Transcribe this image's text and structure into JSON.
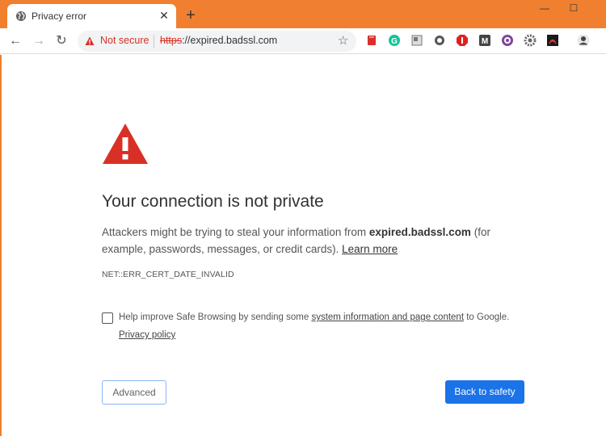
{
  "tab": {
    "title": "Privacy error",
    "close_glyph": "✕",
    "new_tab_glyph": "+"
  },
  "window": {
    "minimize_glyph": "—",
    "maximize_glyph": "☐"
  },
  "toolbar": {
    "back_glyph": "←",
    "forward_glyph": "→",
    "reload_glyph": "↻",
    "security_label": "Not secure",
    "url_scheme": "https",
    "url_rest": "://expired.badssl.com",
    "star_glyph": "☆"
  },
  "extensions": [
    {
      "name": "book-extension-icon",
      "color": "#d9302c"
    },
    {
      "name": "grammarly-extension-icon",
      "color": "#15c39a"
    },
    {
      "name": "screenshot-extension-icon",
      "color": "#777777"
    },
    {
      "name": "circle-extension-icon",
      "color": "#555555"
    },
    {
      "name": "adblock-extension-icon",
      "color": "#e02020"
    },
    {
      "name": "m-extension-icon",
      "color": "#444444"
    },
    {
      "name": "tor-extension-icon",
      "color": "#7d4698"
    },
    {
      "name": "gear-extension-icon",
      "color": "#666666"
    },
    {
      "name": "pdf-extension-icon",
      "color": "#1a1a1a"
    },
    {
      "name": "profile-avatar-icon",
      "color": "#444444"
    }
  ],
  "interstitial": {
    "heading": "Your connection is not private",
    "desc_before": "Attackers might be trying to steal your information from ",
    "desc_host": "expired.badssl.com",
    "desc_after": " (for example, passwords, messages, or credit cards). ",
    "learn_more": "Learn more",
    "error_code": "NET::ERR_CERT_DATE_INVALID",
    "safe_browsing_before": "Help improve Safe Browsing by sending some ",
    "safe_browsing_link": "system information and page content",
    "safe_browsing_after": " to Google.",
    "privacy_policy": "Privacy policy",
    "advanced_button": "Advanced",
    "back_button": "Back to safety"
  },
  "colors": {
    "frame": "#f08030",
    "danger": "#d93025",
    "primary_button": "#1a73e8"
  }
}
